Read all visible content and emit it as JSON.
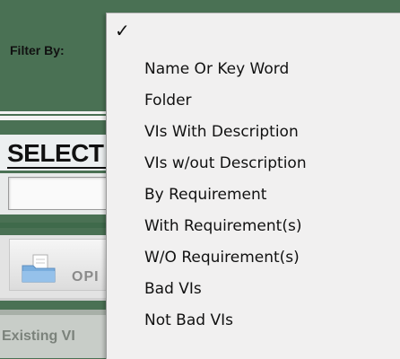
{
  "filter": {
    "label": "Filter By:"
  },
  "background": {
    "select_heading": "SELECT",
    "open_button_label": "OPI",
    "existing_label": "Existing VI"
  },
  "menu": {
    "checkmark": "✓",
    "items": [
      {
        "label": "Name Or Key Word"
      },
      {
        "label": "Folder"
      },
      {
        "label": "VIs With Description"
      },
      {
        "label": "VIs w/out Description"
      },
      {
        "label": "By Requirement"
      },
      {
        "label": "With Requirement(s)"
      },
      {
        "label": "W/O Requirement(s)"
      },
      {
        "label": "Bad VIs"
      },
      {
        "label": "Not Bad VIs"
      }
    ]
  },
  "icons": {
    "open_button_icon": "folder-document-icon",
    "selected_item_icon": "checkmark-icon"
  }
}
